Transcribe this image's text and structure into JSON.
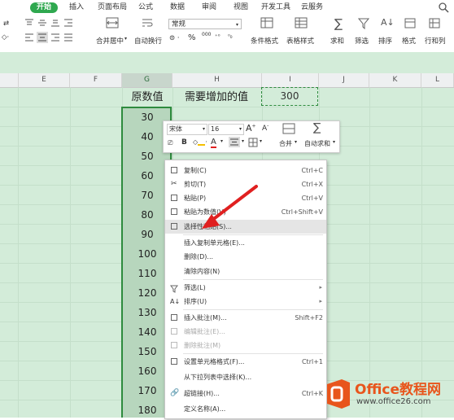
{
  "tabs": {
    "home": "开始",
    "insert": "插入",
    "layout": "页面布局",
    "formula": "公式",
    "data": "数据",
    "review": "审阅",
    "view": "视图",
    "dev": "开发工具",
    "cloud": "云服务"
  },
  "ribbon": {
    "merge_center": "合并居中",
    "wrap_text": "自动换行",
    "number_format": "常规",
    "cond_format": "条件格式",
    "table_style": "表格样式",
    "sum": "求和",
    "filter": "筛选",
    "sort": "排序",
    "format": "格式",
    "row_col": "行和列",
    "percent": "%",
    "thousand": "000"
  },
  "columns": [
    "E",
    "F",
    "G",
    "H",
    "I",
    "J",
    "K",
    "L"
  ],
  "sheet": {
    "g_header": "原数值",
    "h_header": "需要增加的值",
    "i_value": "300",
    "g_values": [
      "30",
      "40",
      "50",
      "60",
      "70",
      "80",
      "90",
      "100",
      "110",
      "120",
      "130",
      "140",
      "150",
      "160",
      "170",
      "180"
    ]
  },
  "mini_toolbar": {
    "font": "宋体",
    "size": "16",
    "bold": "B",
    "font_color": "A",
    "merge": "合并",
    "autosum": "自动求和"
  },
  "menu": {
    "copy": {
      "label": "复制(C)",
      "shortcut": "Ctrl+C"
    },
    "cut": {
      "label": "剪切(T)",
      "shortcut": "Ctrl+X"
    },
    "paste": {
      "label": "粘贴(P)",
      "shortcut": "Ctrl+V"
    },
    "paste_values": {
      "label": "粘贴为数值(V)",
      "shortcut": "Ctrl+Shift+V"
    },
    "paste_special": {
      "label": "选择性粘贴(S)..."
    },
    "insert_copied": {
      "label": "插入复制单元格(E)..."
    },
    "delete": {
      "label": "删除(D)..."
    },
    "clear": {
      "label": "清除内容(N)"
    },
    "filter": {
      "label": "筛选(L)"
    },
    "sort": {
      "label": "排序(U)"
    },
    "insert_comment": {
      "label": "插入批注(M)...",
      "shortcut": "Shift+F2"
    },
    "edit_comment": {
      "label": "编辑批注(E)..."
    },
    "delete_comment": {
      "label": "删除批注(M)"
    },
    "format_cells": {
      "label": "设置单元格格式(F)...",
      "shortcut": "Ctrl+1"
    },
    "pick_list": {
      "label": "从下拉列表中选择(K)..."
    },
    "hyperlink": {
      "label": "超链接(H)...",
      "shortcut": "Ctrl+K"
    },
    "define_name": {
      "label": "定义名称(A)..."
    }
  },
  "watermark": {
    "brand": "Office教程网",
    "url": "www.office26.com"
  },
  "colors": {
    "accent": "#2fa84f",
    "sheet_bg": "#d3ecd9",
    "arrow": "#e02020",
    "logo": "#e8551c"
  }
}
